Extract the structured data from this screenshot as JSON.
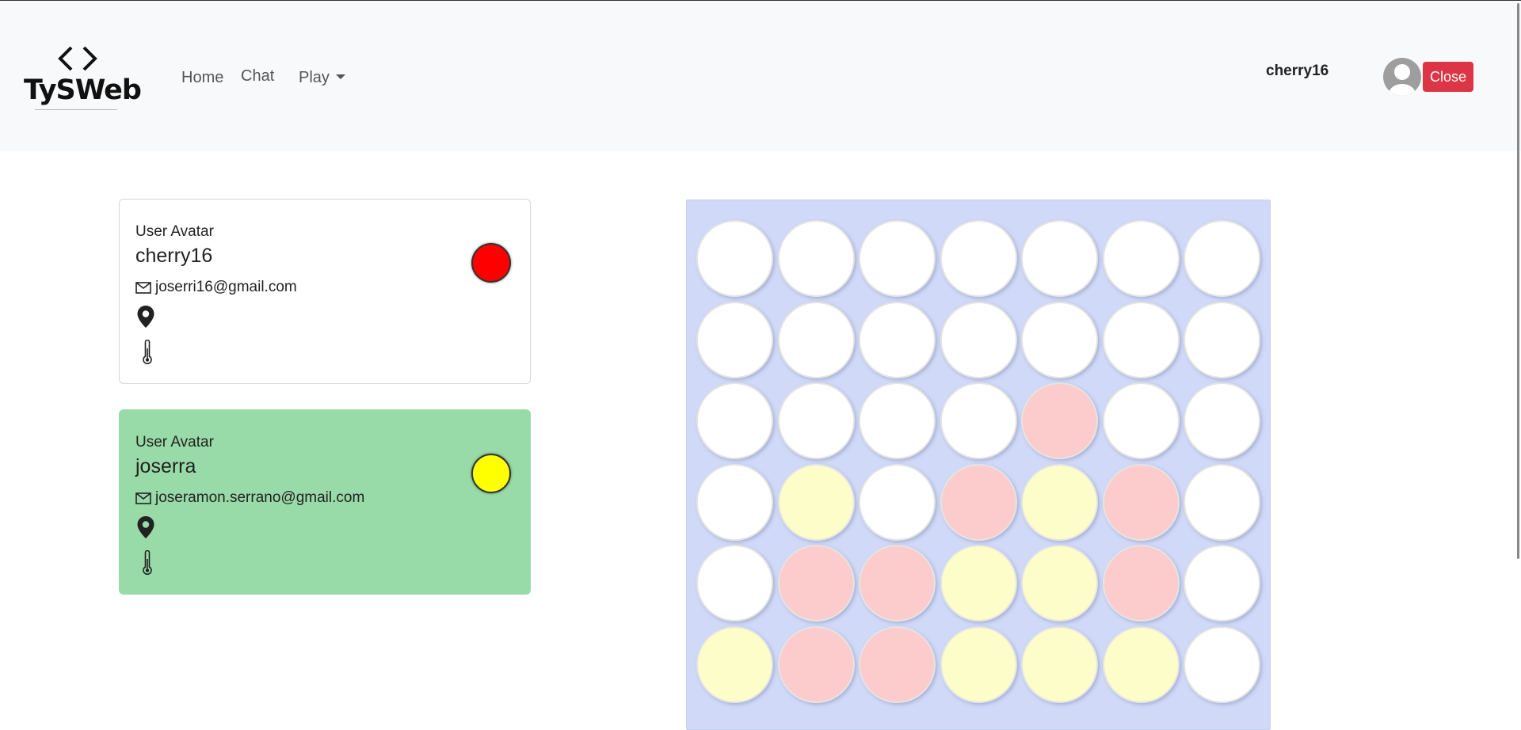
{
  "header": {
    "logo_text": "TySWeb",
    "nav": {
      "home": "Home",
      "chat": "Chat",
      "play": "Play"
    },
    "current_user": "cherry16",
    "close_label": "Close"
  },
  "players": [
    {
      "avatar_label": "User Avatar",
      "name": "cherry16",
      "email": "joserri16@gmail.com",
      "disc_color": "#ff0000",
      "active": false
    },
    {
      "avatar_label": "User Avatar",
      "name": "joserra",
      "email": "joseramon.serrano@gmail.com",
      "disc_color": "#ffff00",
      "active": true
    }
  ],
  "board": {
    "columns": 7,
    "visible_rows": 6,
    "cells": [
      [
        "empty",
        "empty",
        "empty",
        "empty",
        "empty",
        "empty",
        "empty"
      ],
      [
        "empty",
        "empty",
        "empty",
        "empty",
        "empty",
        "empty",
        "empty"
      ],
      [
        "empty",
        "empty",
        "empty",
        "empty",
        "red",
        "empty",
        "empty"
      ],
      [
        "empty",
        "yellow",
        "empty",
        "red",
        "yellow",
        "red",
        "empty"
      ],
      [
        "empty",
        "red",
        "red",
        "yellow",
        "yellow",
        "red",
        "empty"
      ],
      [
        "yellow",
        "red",
        "red",
        "yellow",
        "yellow",
        "yellow",
        "empty"
      ]
    ]
  },
  "colors": {
    "navbar_bg": "#f8f9fa",
    "board_bg": "#d0d9f7",
    "active_card_bg": "#98dba8",
    "close_button": "#dc3545",
    "red_piece": "#fccccc",
    "yellow_piece": "#fdfdca"
  }
}
